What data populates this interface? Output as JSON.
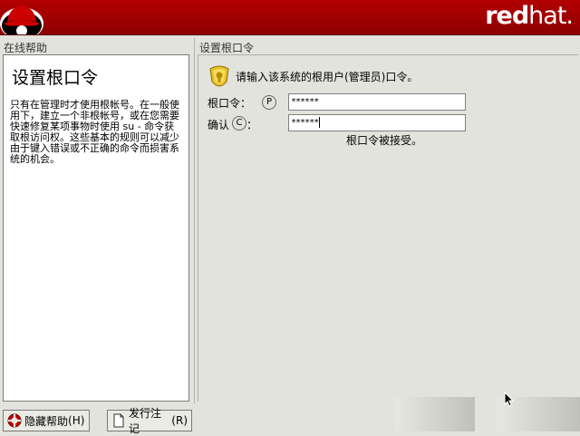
{
  "header": {
    "brand_bold": "red",
    "brand_light": "hat."
  },
  "help": {
    "panel_title": "在线帮助",
    "heading": "设置根口令",
    "body": "只有在管理时才使用根帐号。在一般使用下，建立一个非根帐号，或在您需要快速修复某项事物时使用 su - 命令获取根访问权。这些基本的规则可以减少由于键入错误或不正确的命令而损害系统的机会。"
  },
  "root_password": {
    "section_title": "设置根口令",
    "prompt": "请输入该系统的根用户(管理员)口令。",
    "password_label": "根口令：",
    "password_mnemonic": "P",
    "password_value": "******",
    "confirm_label": "确认",
    "confirm_mnemonic": "C",
    "confirm_colon": "：",
    "confirm_value": "******",
    "status": "根口令被接受。"
  },
  "footer": {
    "hide_help_label": "隐藏帮助",
    "hide_help_mnemonic": "(H)",
    "release_notes_label": "发行注记",
    "release_notes_mnemonic": "(R)"
  }
}
